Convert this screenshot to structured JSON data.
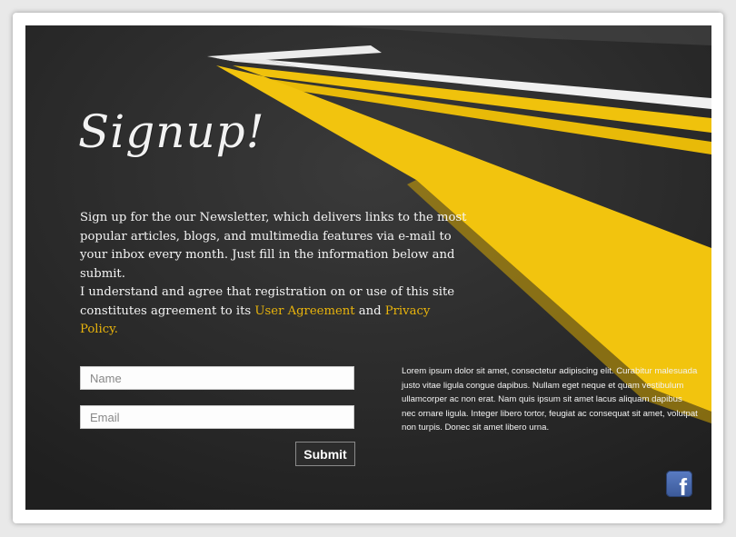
{
  "page": {
    "title": "Signup!",
    "intro": "Sign up for the our Newsletter, which delivers links to the most popular articles, blogs, and multimedia features via e-mail to your inbox every month. Just fill in the information below and submit.",
    "agreement_prefix": "I understand and agree that registration on or use of this site constitutes agreement to its ",
    "user_agreement_link": "User Agreement",
    "agreement_and": " and ",
    "privacy_link": "Privacy Policy."
  },
  "form": {
    "name_placeholder": "Name",
    "email_placeholder": "Email",
    "submit_label": "Submit"
  },
  "sidebar": {
    "lorem": "Lorem ipsum dolor sit amet, consectetur adipiscing elit. Curabitur malesuada justo vitae ligula congue dapibus. Nullam eget neque et quam vestibulum ullamcorper ac non erat. Nam quis ipsum sit amet lacus aliquam dapibus nec ornare ligula. Integer libero tortor, feugiat ac consequat sit amet, volutpat non turpis. Donec sit amet libero urna."
  },
  "social": {
    "facebook_icon": "facebook-icon"
  },
  "colors": {
    "accent": "#e9b40c",
    "stripe_yellow": "#f0c20c",
    "asphalt": "#2b2b2b",
    "facebook": "#3b5998"
  }
}
